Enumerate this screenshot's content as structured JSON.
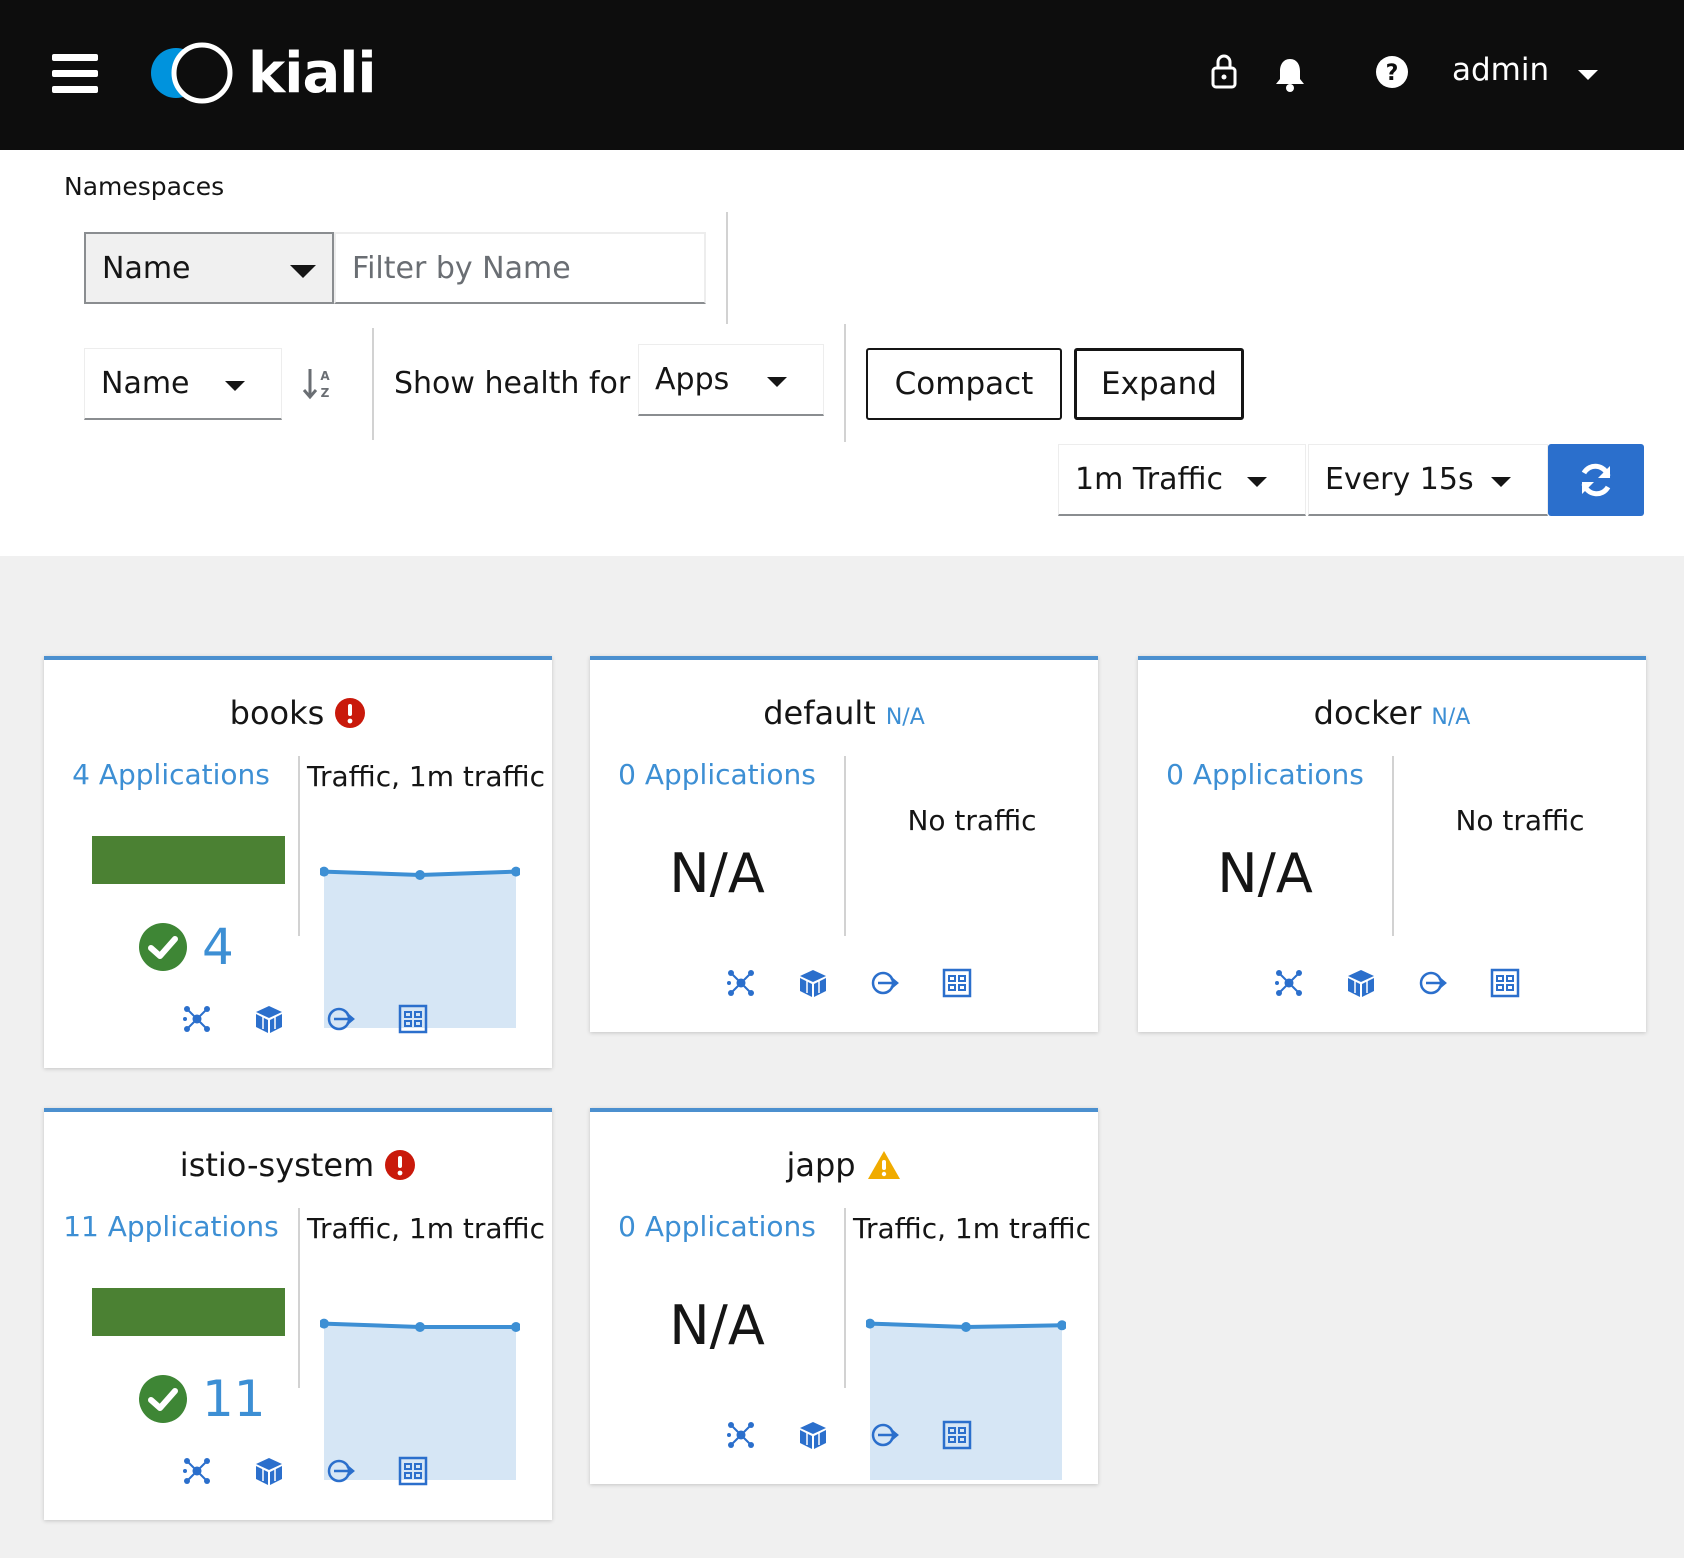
{
  "masthead": {
    "brand": "kiali",
    "user": "admin",
    "icons": [
      "menu-icon",
      "lock-icon",
      "bell-icon",
      "help-icon",
      "chevron-down-icon"
    ]
  },
  "toolbar": {
    "title": "Namespaces",
    "filter_type": "Name",
    "filter_placeholder": "Filter by Name",
    "sort_field": "Name",
    "show_health_label": "Show health for",
    "health_for": "Apps",
    "compact_label": "Compact",
    "expand_label": "Expand",
    "duration": "1m Traffic",
    "refresh_interval": "Every 15s"
  },
  "colors": {
    "accent": "#2b6fcc",
    "link": "#3d8fd4",
    "healthy": "#3e8635",
    "danger": "#c9190b",
    "warning": "#f0ab00"
  },
  "cards": [
    {
      "name": "books",
      "status": "error",
      "applications": "4 Applications",
      "health_count": "4",
      "traffic_title": "Traffic, 1m traffic",
      "traffic_values": [
        0.92,
        0.9,
        0.92
      ]
    },
    {
      "name": "default",
      "status_text": "N/A",
      "applications": "0 Applications",
      "health_value": "N/A",
      "traffic_text": "No traffic"
    },
    {
      "name": "docker",
      "status_text": "N/A",
      "applications": "0 Applications",
      "health_value": "N/A",
      "traffic_text": "No traffic"
    },
    {
      "name": "istio-system",
      "status": "error",
      "applications": "11 Applications",
      "health_count": "11",
      "traffic_title": "Traffic, 1m traffic",
      "traffic_values": [
        0.92,
        0.9,
        0.9
      ]
    },
    {
      "name": "japp",
      "status": "warning",
      "applications": "0 Applications",
      "health_value": "N/A",
      "traffic_title": "Traffic, 1m traffic",
      "traffic_values": [
        0.92,
        0.9,
        0.91
      ]
    }
  ],
  "card_links": [
    "topology-icon",
    "applications-icon",
    "workloads-icon",
    "services-icon"
  ]
}
